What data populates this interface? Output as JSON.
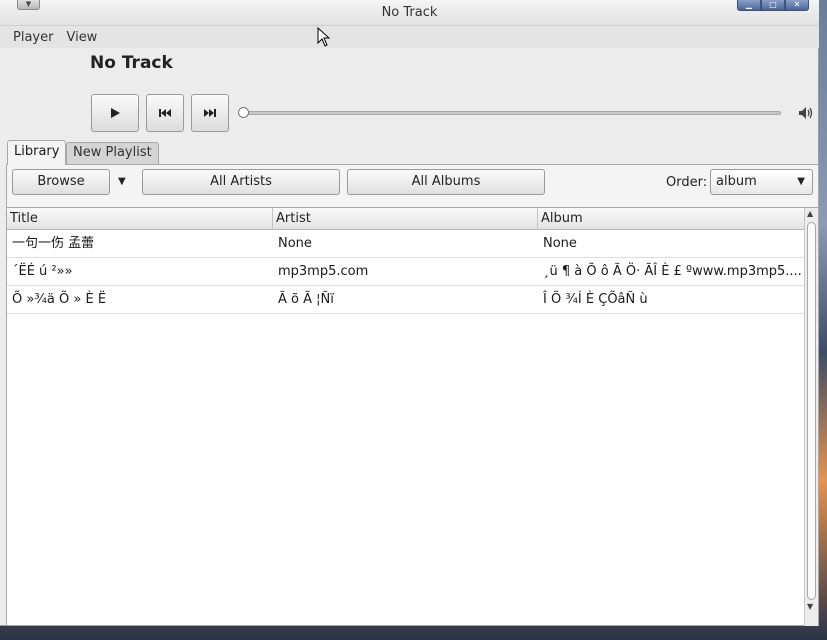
{
  "window": {
    "title": "No Track"
  },
  "menubar": {
    "items": [
      "Player",
      "View"
    ]
  },
  "player": {
    "track_title": "No Track",
    "progress": 0
  },
  "tabs": [
    {
      "label": "Library",
      "active": true
    },
    {
      "label": "New Playlist",
      "active": false
    }
  ],
  "toolbar": {
    "browse_label": "Browse",
    "all_artists_label": "All Artists",
    "all_albums_label": "All Albums",
    "order_label": "Order:",
    "order_value": "album"
  },
  "table": {
    "columns": [
      "Title",
      "Artist",
      "Album"
    ],
    "rows": [
      {
        "title": "一句一伤 孟蕾",
        "artist": "None",
        "album": "None"
      },
      {
        "title": "´ËÉ  ú ²»»",
        "artist": "mp3mp5.com",
        "album": "¸ü ¶ à  Õ ô Ã Ö·  ÃÎ È  £ ºwww.mp3mp5...."
      },
      {
        "title": "Õ »¾ä Õ » È Ë",
        "artist": " Ã õ Ã ¦Ñï",
        "album": "Î Õ ¾Í È ÇÕâÑ ù"
      }
    ]
  },
  "colors": {
    "scrollbar_thumb": "#fafafa",
    "window_bg": "#ececec"
  }
}
